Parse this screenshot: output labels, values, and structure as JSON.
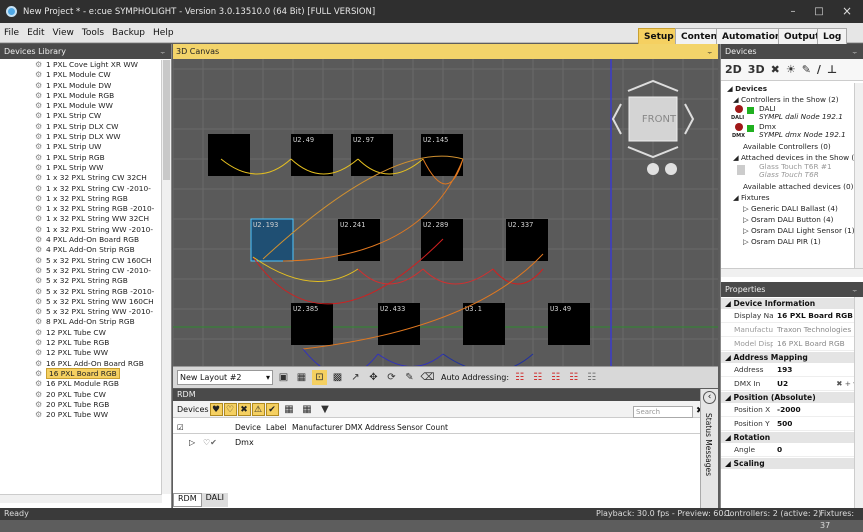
{
  "window": {
    "title": "New Project * - e:cue SYMPHOLIGHT - Version 3.0.13510.0 (64 Bit) [FULL VERSION]",
    "minimize": "–",
    "maximize": "□",
    "close": "×"
  },
  "menu": [
    "File",
    "Edit",
    "View",
    "Tools",
    "Backup",
    "Help"
  ],
  "modes": [
    "Setup",
    "Content",
    "Automation",
    "Output",
    "Log"
  ],
  "library": {
    "title": "Devices Library",
    "items": [
      "1 PXL Cove Light XR WW",
      "1 PXL Module CW",
      "1 PXL Module DW",
      "1 PXL Module RGB",
      "1 PXL Module WW",
      "1 PXL Strip CW",
      "1 PXL Strip DLX CW",
      "1 PXL Strip DLX WW",
      "1 PXL Strip UW",
      "1 PXL Strip RGB",
      "1 PXL Strip WW",
      "1 x 32 PXL String CW 32CH",
      "1 x 32 PXL String CW -2010-",
      "1 x 32 PXL String RGB",
      "1 x 32 PXL String RGB -2010-",
      "1 x 32 PXL String WW 32CH",
      "1 x 32 PXL String WW -2010-",
      "4 PXL Add-On Board RGB",
      "4 PXL Add-On Strip RGB",
      "5 x 32 PXL String CW 160CH",
      "5 x 32 PXL String CW -2010-",
      "5 x 32 PXL String RGB",
      "5 x 32 PXL String RGB -2010-",
      "5 x 32 PXL String WW 160CH",
      "5 x 32 PXL String WW -2010-",
      "8 PXL Add-On Strip RGB",
      "12 PXL Tube CW",
      "12 PXL Tube RGB",
      "12 PXL Tube WW",
      "16 PXL Add-On Board RGB",
      "16 PXL Board RGB",
      "16 PXL Module RGB",
      "20 PXL Tube CW",
      "20 PXL Tube RGB",
      "20 PXL Tube WW"
    ],
    "selected_index": 30
  },
  "canvas": {
    "title": "3D Canvas",
    "front_label": "FRONT",
    "device_labels": [
      "",
      "U2.49",
      "U2.97",
      "U2.145",
      "U2.193",
      "U2.241",
      "U2.289",
      "U2.337",
      "U2.385",
      "U2.433",
      "U3.1",
      "U3.49"
    ]
  },
  "toolbar": {
    "layout": "New Layout #2",
    "auto_addressing": "Auto Addressing:"
  },
  "rdm": {
    "title": "RDM",
    "devices_label": "Devices",
    "search_placeholder": "Search",
    "columns": [
      "Device",
      "Label",
      "Manufacturer",
      "DMX Address",
      "Sensor Count"
    ],
    "row_device": "Dmx",
    "tabs": [
      "RDM",
      "DALI"
    ],
    "status_messages": "Status Messages"
  },
  "devices": {
    "title": "Devices",
    "view2d": "2D",
    "view3d": "3D",
    "root": "Devices",
    "controllers_header": "Controllers in the Show (2)",
    "controller1_name": "DALI",
    "controller1_sub": "SYMPL dali Node 192.1",
    "controller1_badge": "DALI",
    "controller2_name": "Dmx",
    "controller2_sub": "SYMPL dmx Node 192.1",
    "controller2_badge": "DMX",
    "available_controllers": "Available Controllers (0)",
    "attached_header": "Attached devices in the Show (1)",
    "attached_name": "Glass Touch T6R #1",
    "attached_sub": "Glass Touch T6R",
    "available_attached": "Available attached devices (0)",
    "fixtures": "Fixtures",
    "fixture_items": [
      "Generic DALI Ballast (4)",
      "Osram DALI Button (4)",
      "Osram DALI Light Sensor (1)",
      "Osram DALI PIR (1)"
    ]
  },
  "properties": {
    "title": "Properties",
    "sections": {
      "info": "Device Information",
      "mapping": "Address Mapping",
      "position": "Position (Absolute)",
      "rotation": "Rotation",
      "scaling": "Scaling"
    },
    "display_name": {
      "k": "Display Name",
      "v": "16 PXL Board RGB #"
    },
    "manufacturer": {
      "k": "Manufacturer",
      "v": "Traxon Technologies"
    },
    "model": {
      "k": "Model DisplayN",
      "v": "16 PXL Board RGB"
    },
    "address": {
      "k": "Address",
      "v": "193"
    },
    "dmx_in": {
      "k": "DMX In",
      "v": "U2"
    },
    "pos_x": {
      "k": "Position X",
      "v": "-2000"
    },
    "pos_y": {
      "k": "Position Y",
      "v": "500"
    },
    "angle": {
      "k": "Angle",
      "v": "0"
    }
  },
  "status": {
    "ready": "Ready",
    "playback": "Playback: 30.0 fps - Preview: 60.1",
    "controllers": "Controllers: 2 (active: 2)",
    "fixtures": "Fixtures: 37"
  },
  "colors": {
    "accent": "#f5d061",
    "selected_fixture": "#1f4f73",
    "device_box": "#000000",
    "canvas_bg": "#5a5a5a"
  }
}
